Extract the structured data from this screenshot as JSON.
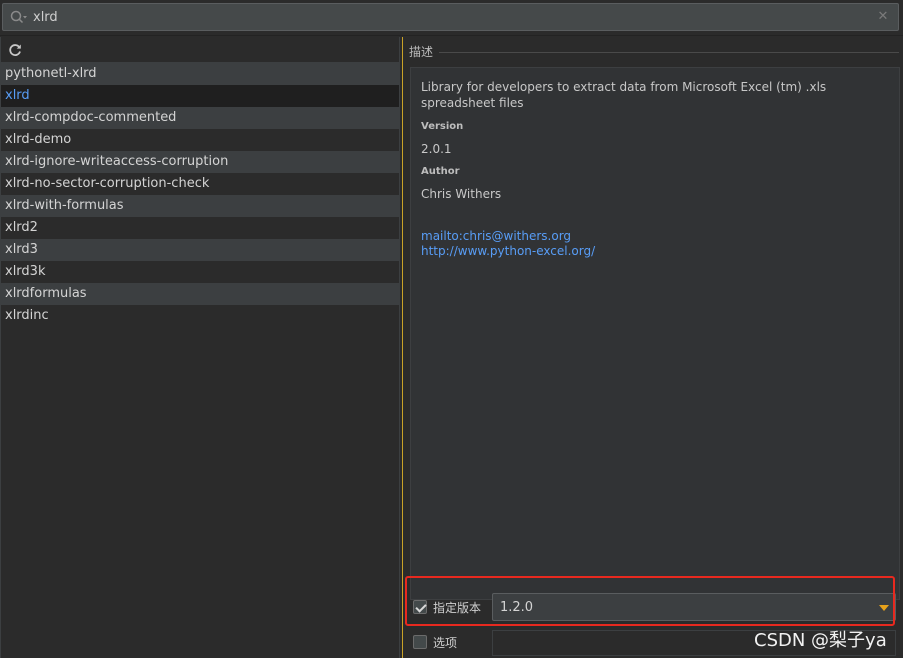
{
  "search": {
    "value": "xlrd",
    "clear_icon": "close-icon",
    "search_icon": "search-icon"
  },
  "toolbar": {
    "refresh_icon": "refresh-icon"
  },
  "packages": [
    "pythonetl-xlrd",
    "xlrd",
    "xlrd-compdoc-commented",
    "xlrd-demo",
    "xlrd-ignore-writeaccess-corruption",
    "xlrd-no-sector-corruption-check",
    "xlrd-with-formulas",
    "xlrd2",
    "xlrd3",
    "xlrd3k",
    "xlrdformulas",
    "xlrdinc"
  ],
  "selected_package": "xlrd",
  "description": {
    "title": "描述",
    "summary": "Library for developers to extract data from Microsoft Excel (tm) .xls spreadsheet files",
    "version_label": "Version",
    "version_value": "2.0.1",
    "author_label": "Author",
    "author_value": "Chris Withers",
    "link_email": "mailto:chris@withers.org",
    "link_site": "http://www.python-excel.org/"
  },
  "options": {
    "specify_version_label": "指定版本",
    "specify_version_checked": true,
    "selected_version": "1.2.0",
    "options_label": "选项",
    "options_checked": false
  },
  "watermark": "CSDN @梨子ya",
  "colors": {
    "link": "#589df6",
    "highlight": "#e8291f",
    "splitter": "#c9a227",
    "dropdown_arrow": "#e8a31b"
  }
}
